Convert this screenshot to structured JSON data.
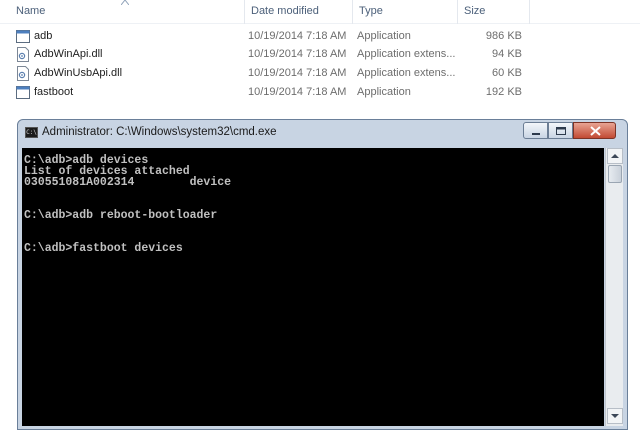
{
  "explorer": {
    "columns": [
      "Name",
      "Date modified",
      "Type",
      "Size"
    ],
    "files": [
      {
        "name": "adb",
        "date": "10/19/2014 7:18 AM",
        "type": "Application",
        "size": "986 KB",
        "icon": "application-icon"
      },
      {
        "name": "AdbWinApi.dll",
        "date": "10/19/2014 7:18 AM",
        "type": "Application extens...",
        "size": "94 KB",
        "icon": "dll-icon"
      },
      {
        "name": "AdbWinUsbApi.dll",
        "date": "10/19/2014 7:18 AM",
        "type": "Application extens...",
        "size": "60 KB",
        "icon": "dll-icon"
      },
      {
        "name": "fastboot",
        "date": "10/19/2014 7:18 AM",
        "type": "Application",
        "size": "192 KB",
        "icon": "application-icon"
      }
    ]
  },
  "cmd": {
    "icon_label": "C:\\",
    "title": "Administrator: C:\\Windows\\system32\\cmd.exe",
    "console_text": "C:\\adb>adb devices\nList of devices attached\n030551081A002314        device\n\n\nC:\\adb>adb reboot-bootloader\n\n\nC:\\adb>fastboot devices",
    "colors": {
      "background": "#000000",
      "text": "#c0c0c0",
      "close_button": "#c24a33"
    }
  }
}
